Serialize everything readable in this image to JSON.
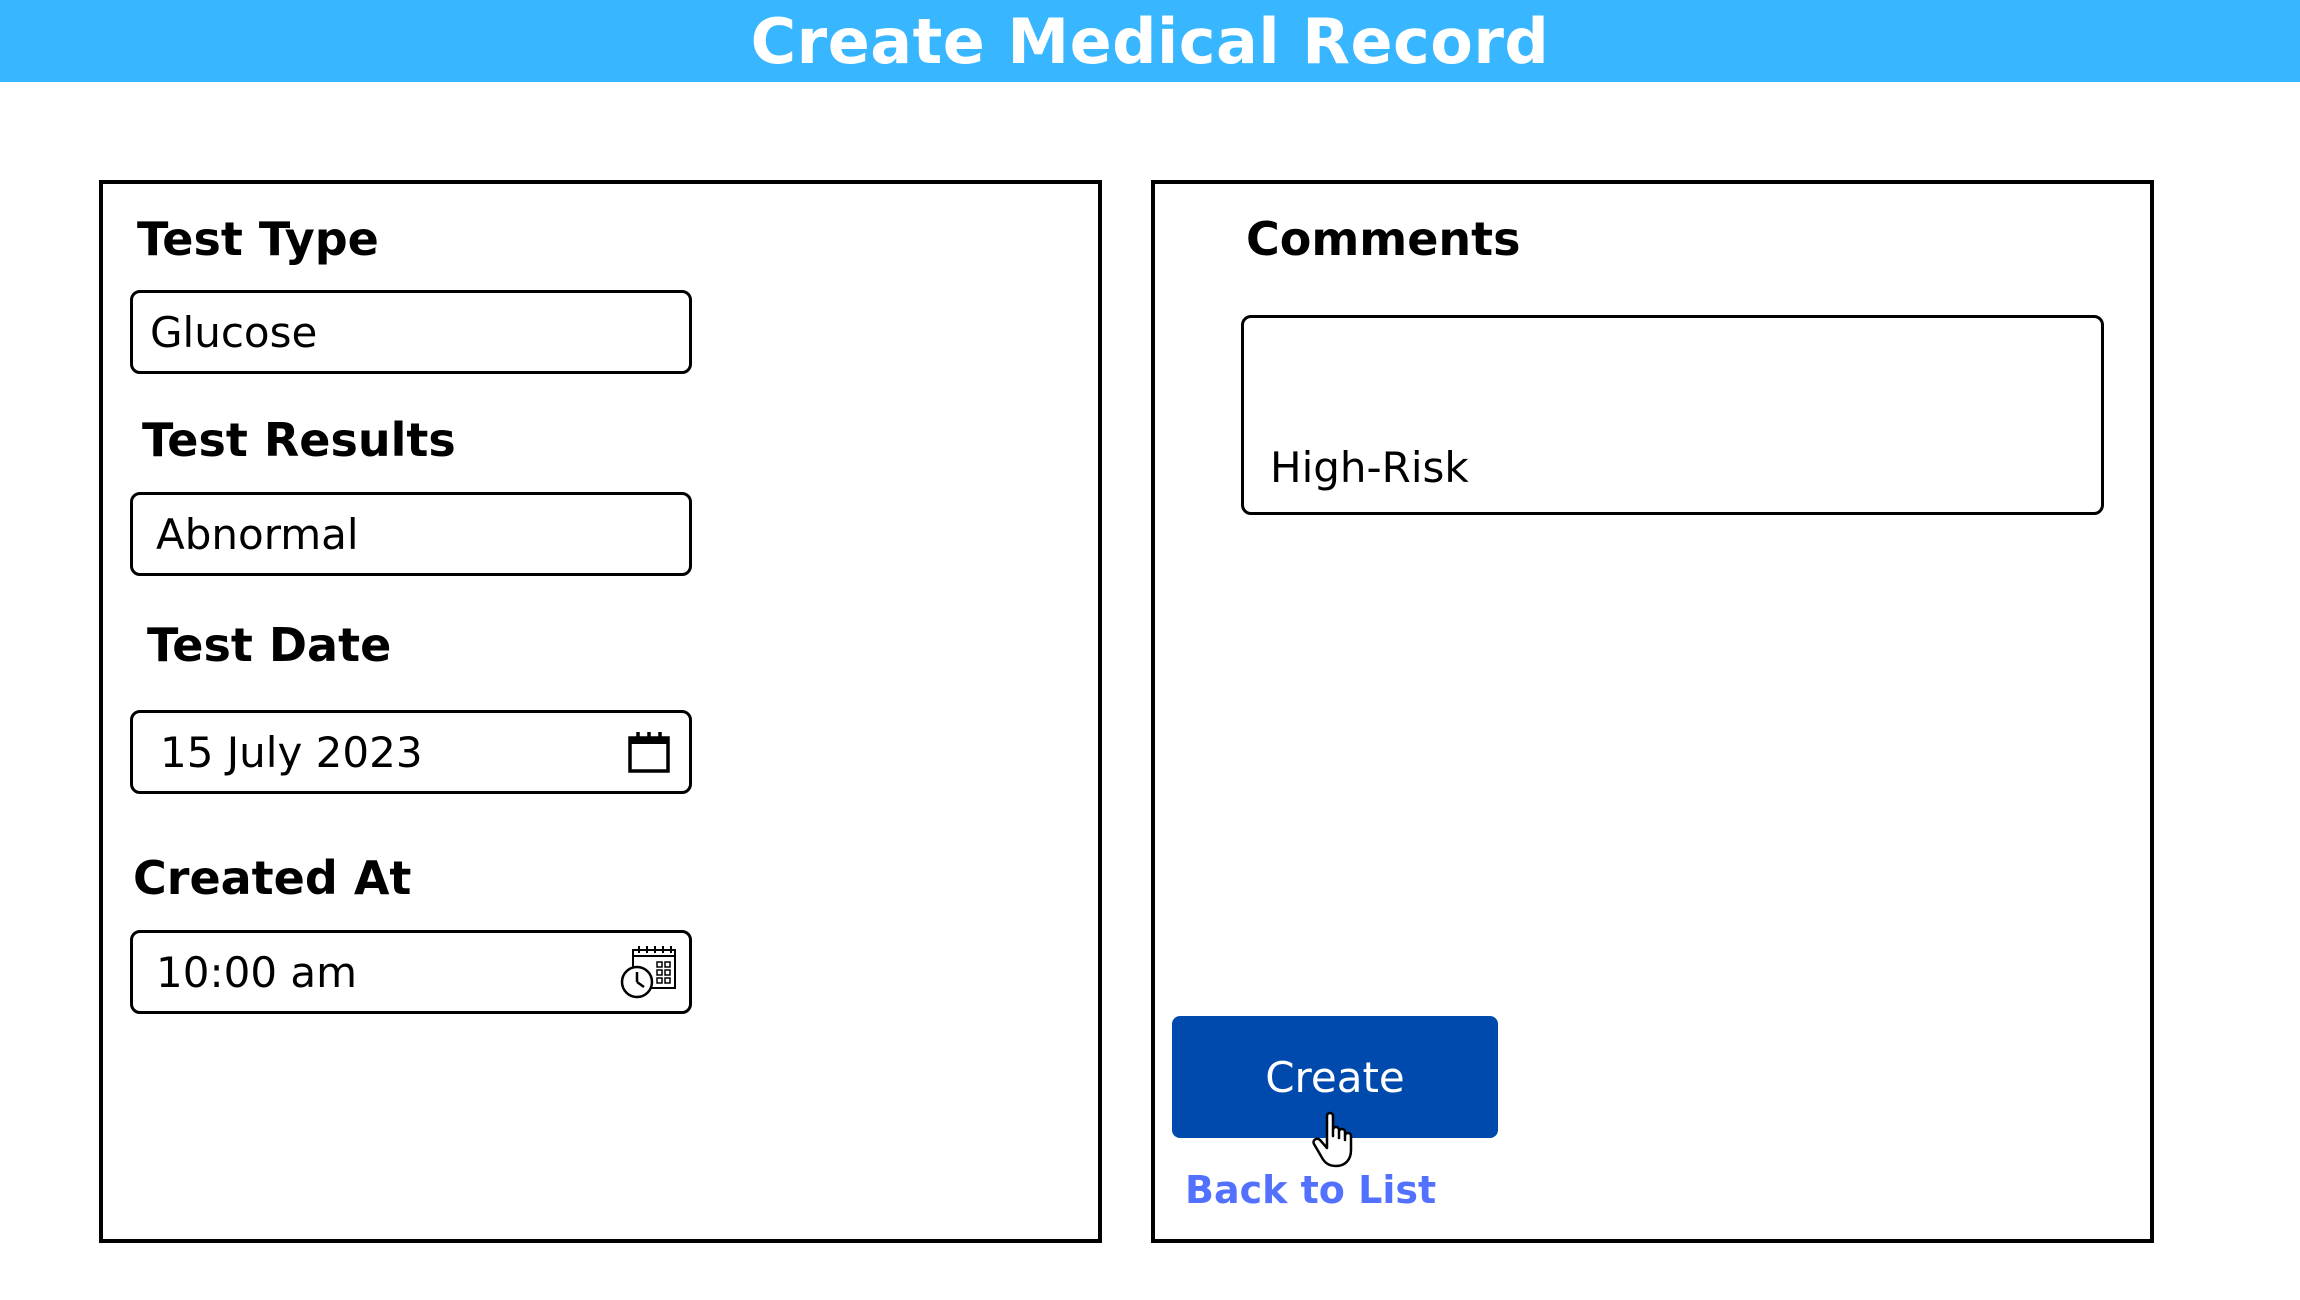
{
  "header": {
    "title": "Create Medical Record",
    "background_color": "#38b6ff"
  },
  "form": {
    "test_type": {
      "label": "Test Type",
      "value": "Glucose"
    },
    "test_results": {
      "label": "Test Results",
      "value": "Abnormal"
    },
    "test_date": {
      "label": "Test Date",
      "value": "15 July 2023",
      "icon": "calendar-icon"
    },
    "created_at": {
      "label": "Created At",
      "value": "10:00 am",
      "icon": "calendar-clock-icon"
    },
    "comments": {
      "label": "Comments",
      "value": "High-Risk"
    }
  },
  "actions": {
    "create_label": "Create",
    "create_color": "#004aad",
    "back_label": "Back to List",
    "back_color": "#5271ff",
    "cursor_icon": "hand-pointer-icon"
  }
}
